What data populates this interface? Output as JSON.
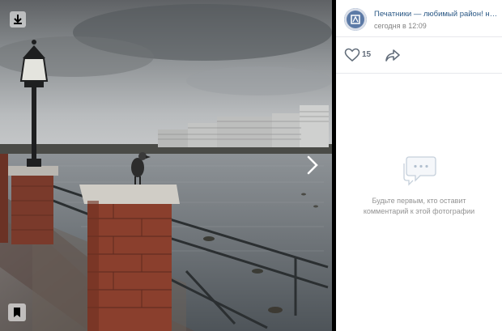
{
  "post": {
    "group_name": "Печатники — любимый район! над...",
    "time": "сегодня в 12:09"
  },
  "actions": {
    "likes_count": "15"
  },
  "comments": {
    "empty_text": "Будьте первым, кто оставит комментарий к этой фотографии"
  },
  "icons": {
    "download": "download-icon",
    "bookmark": "bookmark-icon",
    "next": "chevron-right-icon",
    "like": "heart-icon",
    "share": "share-arrow-icon",
    "comments": "comment-bubble-icon"
  },
  "colors": {
    "link": "#2a5885",
    "meta": "#828282",
    "divider": "#e7e8ec",
    "icon": "#626d7a"
  }
}
